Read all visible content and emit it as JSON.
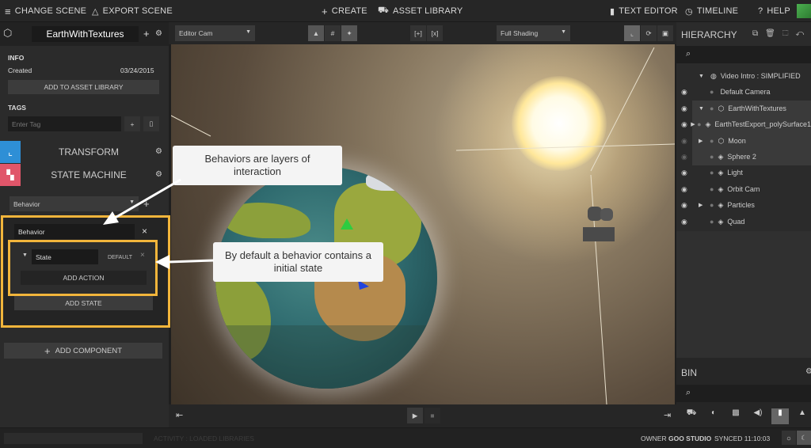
{
  "topbar": {
    "change_scene": "CHANGE SCENE",
    "export_scene": "EXPORT SCENE",
    "create": "CREATE",
    "asset_library": "ASSET LIBRARY",
    "text_editor": "TEXT EDITOR",
    "timeline": "TIMELINE",
    "help": "HELP"
  },
  "inspector": {
    "scene_name": "EarthWithTextures",
    "info_title": "INFO",
    "created_label": "Created",
    "created_date": "03/24/2015",
    "add_to_library": "ADD TO ASSET LIBRARY",
    "tags_title": "TAGS",
    "tag_placeholder": "Enter Tag",
    "transform": "TRANSFORM",
    "state_machine": "STATE MACHINE",
    "behavior_select": "Behavior",
    "behavior_name": "Behavior",
    "state_name": "State",
    "default_label": "DEFAULT",
    "add_action": "ADD ACTION",
    "add_state": "ADD STATE",
    "add_component": "ADD COMPONENT"
  },
  "viewport": {
    "camera": "Editor Cam",
    "shading": "Full Shading"
  },
  "callouts": {
    "behaviors": "Behaviors are layers of interaction",
    "default_state": "By default a behavior contains a initial state"
  },
  "hierarchy": {
    "title": "HIERARCHY",
    "items": [
      {
        "label": "Video Intro : SIMPLIFIED"
      },
      {
        "label": "Default Camera"
      },
      {
        "label": "EarthWithTextures"
      },
      {
        "label": "EarthTestExport_polySurface1"
      },
      {
        "label": "Moon"
      },
      {
        "label": "Sphere 2"
      },
      {
        "label": "Light"
      },
      {
        "label": "Orbit Cam"
      },
      {
        "label": "Particles"
      },
      {
        "label": "Quad"
      }
    ]
  },
  "bin": {
    "title": "BIN"
  },
  "status": {
    "activity": "ACTIVITY : LOADED LIBRARIES",
    "owner_label": "OWNER",
    "owner": "GOO STUDIO",
    "synced": "SYNCED 11:10:03"
  },
  "colors": {
    "accent": "#f2b53b",
    "transform_icon": "#2e8fd6",
    "state_machine_icon": "#e0566a"
  }
}
